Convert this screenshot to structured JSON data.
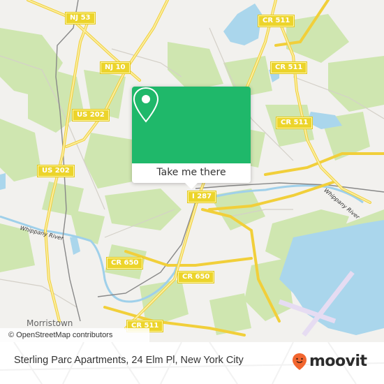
{
  "map": {
    "road_shields": [
      {
        "label": "NJ 53"
      },
      {
        "label": "NJ 10"
      },
      {
        "label": "US 202"
      },
      {
        "label": "US 202"
      },
      {
        "label": "CR 511"
      },
      {
        "label": "CR 511"
      },
      {
        "label": "CR 511"
      },
      {
        "label": "I 287"
      },
      {
        "label": "CR 650"
      },
      {
        "label": "CR 650"
      },
      {
        "label": "CR 511"
      }
    ],
    "places": {
      "morristown": "Morristown"
    },
    "rivers": {
      "whippany_west": "Whippany River",
      "whippany_east": "Whippany River"
    },
    "attribution": "© OpenStreetMap contributors",
    "colors": {
      "land": "#f2f1ee",
      "woods": "#c8e3a6",
      "water": "#a9d8ee",
      "road": "#f7df6a",
      "runway": "#e6dcf2"
    }
  },
  "popup": {
    "icon": "map-pin-icon",
    "button_label": "Take me there",
    "color": "#1fb86a"
  },
  "footer": {
    "address": "Sterling Parc Apartments, 24 Elm Pl, New York City",
    "brand": "moovit",
    "brand_color": "#f2662f"
  }
}
